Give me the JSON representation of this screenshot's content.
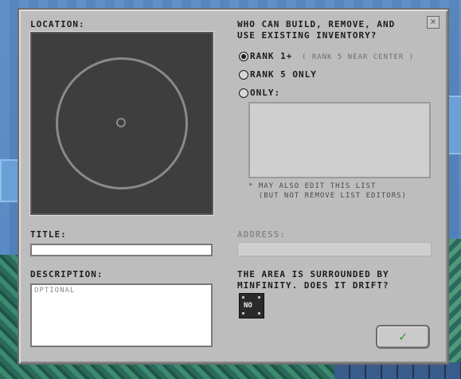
{
  "dialog": {
    "close_symbol": "×",
    "location_label": "LOCATION:",
    "permissions_title": "WHO CAN BUILD, REMOVE, AND\nUSE EXISTING INVENTORY?",
    "options": [
      {
        "label": "RANK 1+",
        "note": "( RANK 5 NEAR CENTER )",
        "selected": true
      },
      {
        "label": "RANK 5 ONLY",
        "note": "",
        "selected": false
      },
      {
        "label": "ONLY:",
        "note": "",
        "selected": false
      }
    ],
    "editors_note": "* MAY ALSO EDIT THIS LIST\n  (BUT NOT REMOVE LIST EDITORS)",
    "title_label": "TITLE:",
    "title_value": "",
    "address_label": "ADDRESS:",
    "address_value": "",
    "description_label": "DESCRIPTION:",
    "description_placeholder": "OPTIONAL",
    "drift_question": "THE AREA IS SURROUNDED BY\nMINFINITY. DOES IT DRIFT?",
    "drift_value": "NO",
    "confirm_symbol": "✓"
  },
  "icons": {
    "close": "close-icon",
    "confirm": "checkmark-icon",
    "map": "location-map"
  },
  "colors": {
    "dialog_bg": "#bdbdbd",
    "map_bg": "#3e3e3e",
    "confirm": "#2f8a2f"
  }
}
